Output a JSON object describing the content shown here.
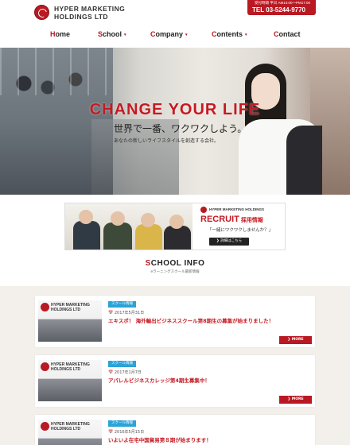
{
  "header": {
    "logo_line1": "HYPER MARKETING",
    "logo_line2": "HOLDINGS LTD",
    "contact_hours": "受付時間 平日 AM10:00〜PM17:00",
    "contact_tel": "TEL 03-5244-9770"
  },
  "nav": {
    "items": [
      {
        "first": "H",
        "rest": "ome",
        "dropdown": ""
      },
      {
        "first": "S",
        "rest": "chool",
        "dropdown": "▾"
      },
      {
        "first": "C",
        "rest": "ompany",
        "dropdown": "▾"
      },
      {
        "first": "C",
        "rest": "ontents",
        "dropdown": "▾"
      },
      {
        "first": "C",
        "rest": "ontact",
        "dropdown": ""
      }
    ]
  },
  "hero": {
    "title": "CHANGE YOUR LIFE",
    "subtitle": "世界で一番、ワクワクしよう。",
    "caption": "あなたの新しいライフスタイルを創造する会社。"
  },
  "recruit": {
    "company": "HYPER MARKETING HOLDINGS",
    "title": "RECRUIT",
    "title_sub": "採用情報",
    "tagline": "「一緒にワクワクしませんか？」",
    "button": "❯ 詳細はこちら"
  },
  "school": {
    "heading_first": "S",
    "heading_rest": "CHOOL INFO",
    "subheading": "eラーニングスクール最新情報"
  },
  "news": [
    {
      "thumb_line1": "HYPER MARKETING",
      "thumb_line2": "HOLDINGS LTD",
      "tag": "スクール情報",
      "date": "2017年5月31日",
      "title": "エキスポ！ 海外輸出ビジネススクール第8期生の募集が始まりました！",
      "more": "❯ MORE"
    },
    {
      "thumb_line1": "HYPER MARKETING",
      "thumb_line2": "HOLDINGS LTD",
      "tag": "スクール情報",
      "date": "2017年1月7日",
      "title": "アパレルビジネスカレッジ第4期生募集中！",
      "more": "❯ MORE"
    },
    {
      "thumb_line1": "HYPER MARKETING",
      "thumb_line2": "HOLDINGS LTD",
      "tag": "スクール情報",
      "date": "2016年5月15日",
      "title": "いよいよ在宅中国貿易第８期が始まります！",
      "more": "❯ MORE"
    }
  ],
  "colors": {
    "brand_red": "#b91922",
    "tag_blue": "#2aa3d8",
    "news_background": "#f3f0eb"
  }
}
